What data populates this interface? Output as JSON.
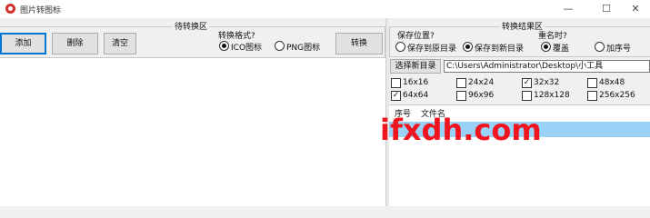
{
  "window": {
    "title": "图片转图标",
    "minimize_glyph": "—",
    "maximize_glyph": "☐",
    "close_glyph": "✕"
  },
  "left": {
    "group_title": "待转换区",
    "buttons": {
      "add": "添加",
      "delete": "删除",
      "clear": "清空",
      "convert": "转换"
    },
    "format_label": "转换格式?",
    "formats": [
      {
        "label": "ICO图标",
        "checked": true
      },
      {
        "label": "PNG图标",
        "checked": false
      }
    ]
  },
  "right": {
    "group_title": "转换结果区",
    "save_location_label": "保存位置?",
    "save_options": [
      {
        "label": "保存到原目录",
        "checked": false
      },
      {
        "label": "保存到新目录",
        "checked": true
      }
    ],
    "rename_label": "重名时?",
    "rename_options": [
      {
        "label": "覆盖",
        "checked": true
      },
      {
        "label": "加序号",
        "checked": false
      }
    ],
    "choose_dir_button": "选择新目录",
    "dir_path": "C:\\Users\\Administrator\\Desktop\\小工具",
    "sizes": [
      {
        "label": "16x16",
        "checked": false
      },
      {
        "label": "24x24",
        "checked": false
      },
      {
        "label": "32x32",
        "checked": true
      },
      {
        "label": "48x48",
        "checked": false
      },
      {
        "label": "64x64",
        "checked": true
      },
      {
        "label": "96x96",
        "checked": false
      },
      {
        "label": "128x128",
        "checked": false
      },
      {
        "label": "256x256",
        "checked": false
      }
    ],
    "columns": {
      "index": "序号",
      "filename": "文件名"
    }
  },
  "watermark": "ifxdh.com"
}
